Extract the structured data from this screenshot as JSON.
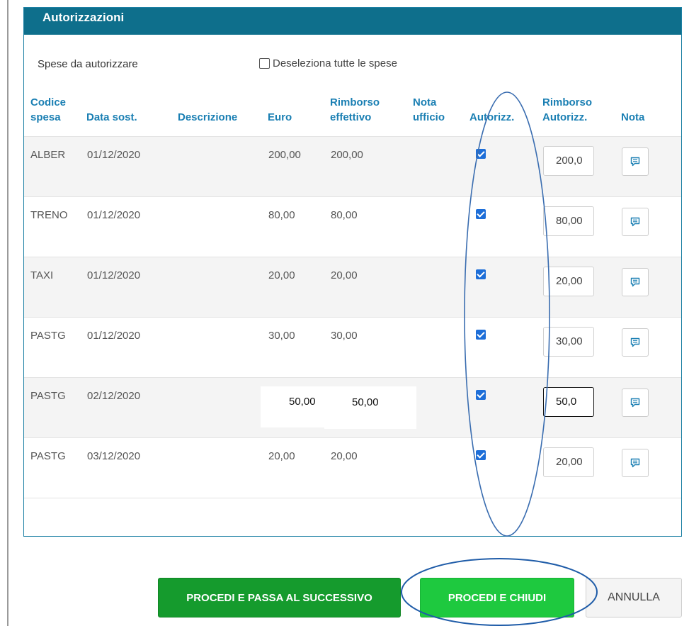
{
  "panel": {
    "title": "Autorizzazioni",
    "subtitle": "Spese da autorizzare",
    "deselect_label": "Deseleziona tutte le spese"
  },
  "table": {
    "headers": {
      "codice_line1": "Codice",
      "codice_line2": "spesa",
      "data": "Data sost.",
      "descrizione": "Descrizione",
      "euro": "Euro",
      "rimborso_line1": "Rimborso",
      "rimborso_line2": "effettivo",
      "nota_ufficio_line1": "Nota",
      "nota_ufficio_line2": "ufficio",
      "autorizz": "Autorizz.",
      "rimborso_aut_line1": "Rimborso",
      "rimborso_aut_line2": "Autorizz.",
      "nota": "Nota"
    },
    "rows": [
      {
        "codice": "ALBER",
        "data": "01/12/2020",
        "descrizione": "",
        "euro": "200,00",
        "rimborso": "200,00",
        "nota_ufficio": "",
        "autorizzato": true,
        "rimborso_autorizzato": "200,0"
      },
      {
        "codice": "TRENO",
        "data": "01/12/2020",
        "descrizione": "",
        "euro": "80,00",
        "rimborso": "80,00",
        "nota_ufficio": "",
        "autorizzato": true,
        "rimborso_autorizzato": "80,00"
      },
      {
        "codice": "TAXI",
        "data": "01/12/2020",
        "descrizione": "",
        "euro": "20,00",
        "rimborso": "20,00",
        "nota_ufficio": "",
        "autorizzato": true,
        "rimborso_autorizzato": "20,00"
      },
      {
        "codice": "PASTG",
        "data": "01/12/2020",
        "descrizione": "",
        "euro": "30,00",
        "rimborso": "30,00",
        "nota_ufficio": "",
        "autorizzato": true,
        "rimborso_autorizzato": "30,00"
      },
      {
        "codice": "PASTG",
        "data": "02/12/2020",
        "descrizione": "",
        "euro": "50,00",
        "rimborso": "50,00",
        "nota_ufficio": "",
        "autorizzato": true,
        "rimborso_autorizzato": "50,0"
      },
      {
        "codice": "PASTG",
        "data": "03/12/2020",
        "descrizione": "",
        "euro": "20,00",
        "rimborso": "20,00",
        "nota_ufficio": "",
        "autorizzato": true,
        "rimborso_autorizzato": "20,00"
      }
    ]
  },
  "buttons": {
    "next": "PROCEDI E PASSA AL SUCCESSIVO",
    "close": "PROCEDI E CHIUDI",
    "cancel": "ANNULLA"
  },
  "icons": {
    "note": "note-icon",
    "checkbox_checked": "checkbox-checked-icon",
    "checkbox_empty": "checkbox-empty-icon"
  },
  "colors": {
    "header_bg": "#0e6f8c",
    "column_header_text": "#1a7fb3",
    "btn_next": "#159b2d",
    "btn_close": "#1ec93f",
    "annotation": "#3a6db0"
  }
}
